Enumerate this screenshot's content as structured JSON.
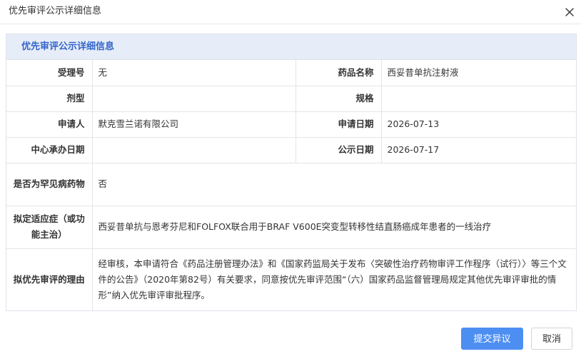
{
  "dialog": {
    "title": "优先审评公示详细信息",
    "close_icon": "close-icon"
  },
  "section": {
    "title": "优先审评公示详细信息"
  },
  "fields": {
    "acceptance_no": {
      "label": "受理号",
      "value": "无"
    },
    "drug_name": {
      "label": "药品名称",
      "value": "西妥昔单抗注射液"
    },
    "dosage_form": {
      "label": "剂型",
      "value": ""
    },
    "specification": {
      "label": "规格",
      "value": ""
    },
    "applicant": {
      "label": "申请人",
      "value": "默克雪兰诺有限公司"
    },
    "application_date": {
      "label": "申请日期",
      "value": "2026-07-13"
    },
    "center_date": {
      "label": "中心承办日期",
      "value": ""
    },
    "publicity_date": {
      "label": "公示日期",
      "value": "2026-07-17"
    },
    "rare_disease": {
      "label": "是否为罕见病药物",
      "value": "否"
    },
    "indication": {
      "label": "拟定适应症（或功能主治）",
      "value": "西妥昔单抗与恩考芬尼和FOLFOX联合用于BRAF V600E突变型转移性结直肠癌成年患者的一线治疗"
    },
    "reason": {
      "label": "拟优先审评的理由",
      "value": "经审核，本申请符合《药品注册管理办法》和《国家药监局关于发布〈突破性治疗药物审评工作程序（试行）〉等三个文件的公告》（2020年第82号）有关要求，同意按优先审评范围“（六）国家药品监督管理局规定其他优先审评审批的情形”纳入优先审评审批程序。"
    }
  },
  "buttons": {
    "submit_objection": "提交异议",
    "cancel": "取消"
  },
  "colors": {
    "section_bg": "#e6edf9",
    "section_title": "#3565c9",
    "primary_button": "#4d8ef2",
    "border": "#e5e5e5"
  }
}
